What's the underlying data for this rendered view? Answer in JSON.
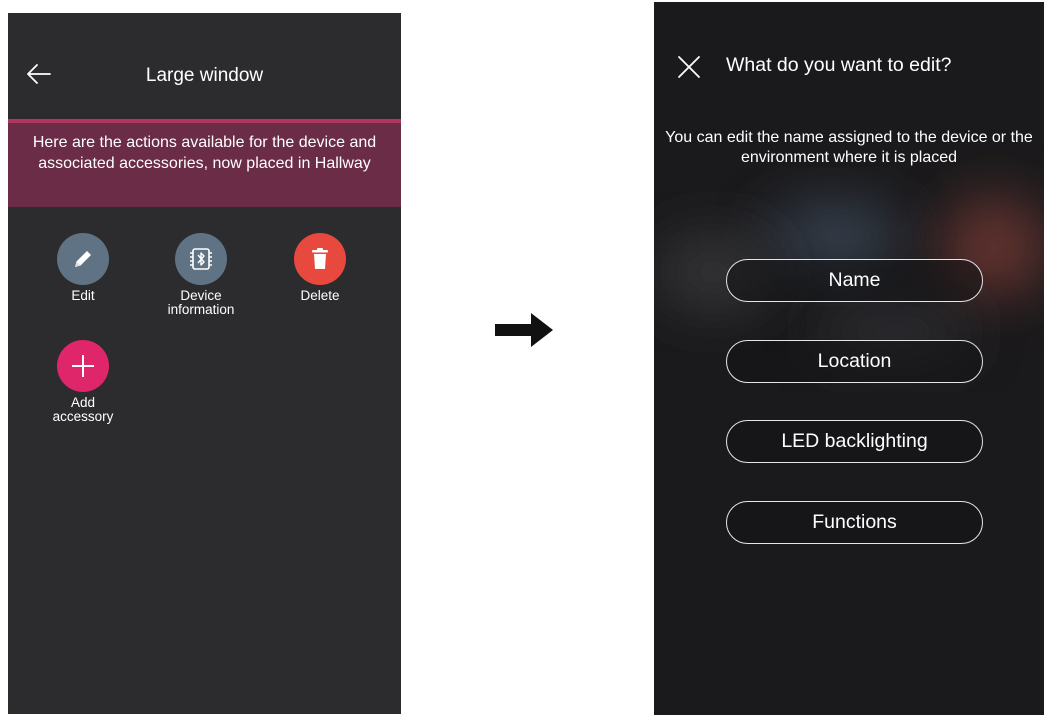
{
  "left_screen": {
    "title": "Large window",
    "banner_text": "Here are the actions available for the device and associated accessories, now placed in Hallway",
    "actions": [
      {
        "label": "Edit",
        "icon": "pencil-icon",
        "color": "#5f7384"
      },
      {
        "label": "Device\ninformation",
        "icon": "bluetooth-chip-icon",
        "color": "#5f7384"
      },
      {
        "label": "Delete",
        "icon": "trash-icon",
        "color": "#e8493e"
      },
      {
        "label": "Add\naccessory",
        "icon": "plus-icon",
        "color": "#e0266a"
      }
    ]
  },
  "right_screen": {
    "title": "What do you want to edit?",
    "description": "You can edit the name assigned to the device or the environment where it is placed",
    "options": [
      {
        "label": "Name"
      },
      {
        "label": "Location"
      },
      {
        "label": "LED backlighting"
      },
      {
        "label": "Functions"
      }
    ]
  },
  "colors": {
    "screen_bg": "#2c2c2e",
    "banner_bg": "#6b2c47",
    "banner_accent": "#b1355f",
    "dialog_bg": "#1a1a1c"
  }
}
